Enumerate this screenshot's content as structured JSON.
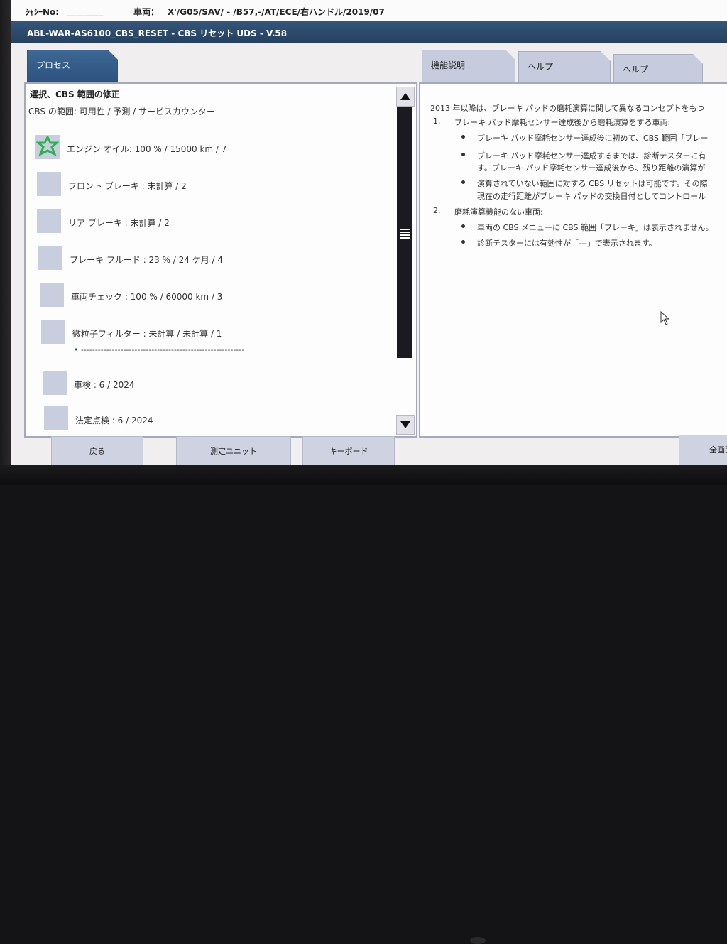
{
  "header": {
    "vin_label": "ｼｬｼｰNo:",
    "vin_value": "＿＿＿＿",
    "vehicle_label": "車両：",
    "vehicle_value": "X'/G05/SAV/ - /B57,-/AT/ECE/右ハンドル/2019/07"
  },
  "title": "ABL-WAR-AS6100_CBS_RESET - CBS リセット UDS - V.58",
  "tabs": {
    "process": "プロセス",
    "function_desc": "機能説明",
    "help1": "ヘルプ",
    "help2": "ヘルプ"
  },
  "left": {
    "title": "選択、CBS 範囲の修正",
    "subtitle": "CBS の範囲: 可用性 / 予測 / サービスカウンター",
    "items": [
      {
        "label": "エンジン オイル: 100 % / 15000 km / 7",
        "icon": "star-icon"
      },
      {
        "label": "フロント ブレーキ : 未計算 / 2",
        "icon": ""
      },
      {
        "label": "リア ブレーキ : 未計算 / 2",
        "icon": ""
      },
      {
        "label": "ブレーキ フルード : 23 % / 24 ケ月 / 4",
        "icon": ""
      },
      {
        "label": "車両チェック : 100 % / 60000 km / 3",
        "icon": ""
      },
      {
        "label": "微粒子フィルター : 未計算 / 未計算 / 1",
        "icon": ""
      },
      {
        "label": "車検 : 6 / 2024",
        "icon": ""
      },
      {
        "label": "法定点検 : 6 / 2024",
        "icon": ""
      }
    ],
    "separator": "•  ----------------------------------------------------------"
  },
  "right": {
    "intro": "2013 年以降は、ブレーキ パッドの磨耗演算に関して異なるコンセプトをもつ",
    "item1_num": "1.",
    "item1_text": "ブレーキ パッド摩耗センサー達成後から磨耗演算をする車両:",
    "b1": "ブレーキ パッド摩耗センサー達成後に初めて、CBS 範囲「ブレー",
    "b2a": "ブレーキ パッド摩耗センサー達成するまでは、診断テスターに有",
    "b2b": "す。ブレーキ パッド摩耗センサー達成後から、残り距離の演算が",
    "b3a": "演算されていない範囲に対する CBS リセットは可能です。その際",
    "b3b": "現在の走行距離がブレーキ パッドの交換日付としてコントロール",
    "item2_num": "2.",
    "item2_text": "磨耗演算機能のない車両:",
    "b4": "車両の CBS メニューに CBS 範囲「ブレーキ」は表示されません。",
    "b5": "診断テスターには有効性が「---」で表示されます。"
  },
  "buttons": {
    "back": "戻る",
    "measure": "測定ユニット",
    "keyboard": "キーボード",
    "fullscreen": "全画面"
  },
  "colors": {
    "title_bar": "#2d4b6e",
    "tab_active": "#35608c",
    "tile": "#c9cedf",
    "star": "#2bb24c"
  }
}
